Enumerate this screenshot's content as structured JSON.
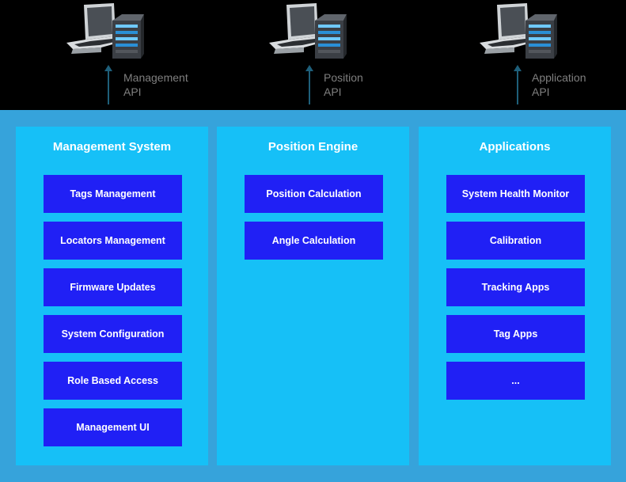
{
  "colors": {
    "top_background": "#000000",
    "main_background": "#36a3db",
    "column_background": "#16c0f7",
    "module_background": "#2020f5",
    "module_text": "#ffffff",
    "api_label_text": "#7f7f7f",
    "arrow": "#1e5f7a"
  },
  "apis": [
    {
      "icon": "laptop-server-icon",
      "line1": "Management",
      "line2": "API"
    },
    {
      "icon": "laptop-server-icon",
      "line1": "Position",
      "line2": "API"
    },
    {
      "icon": "laptop-server-icon",
      "line1": "Application",
      "line2": "API"
    }
  ],
  "columns": [
    {
      "title": "Management System",
      "items": [
        "Tags Management",
        "Locators Management",
        "Firmware Updates",
        "System Configuration",
        "Role Based Access",
        "Management UI"
      ]
    },
    {
      "title": "Position Engine",
      "items": [
        "Position Calculation",
        "Angle Calculation"
      ]
    },
    {
      "title": "Applications",
      "items": [
        "System Health Monitor",
        "Calibration",
        "Tracking Apps",
        "Tag Apps",
        "..."
      ]
    }
  ]
}
